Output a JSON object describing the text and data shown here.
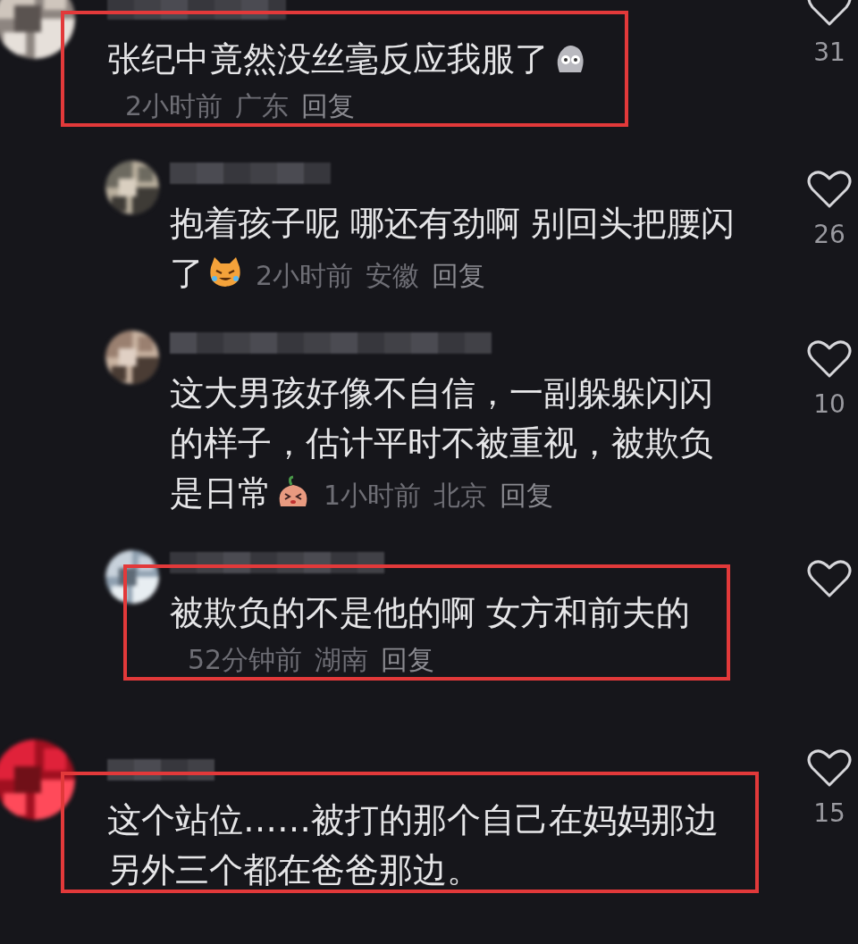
{
  "comments": [
    {
      "kind": "comment",
      "lines": [
        "张纪中竟然没丝毫反应我服了"
      ],
      "emoji": {
        "kind": "shocked"
      },
      "time": "2小时前",
      "location": "广东",
      "reply": "回复",
      "likes": "31",
      "highlighted": true
    },
    {
      "kind": "reply",
      "lines": [
        "抱着孩子呢 哪还有劲啊 别回头把腰闪",
        "了"
      ],
      "emoji": {
        "kind": "crying-laugh"
      },
      "time": "2小时前",
      "location": "安徽",
      "reply": "回复",
      "likes": "26",
      "highlighted": false
    },
    {
      "kind": "reply",
      "lines": [
        "这大男孩好像不自信，一副躲躲闪闪",
        "的样子，估计平时不被重视，被欺负",
        "是日常"
      ],
      "emoji": {
        "kind": "dizzy"
      },
      "time": "1小时前",
      "location": "北京",
      "reply": "回复",
      "likes": "10",
      "highlighted": false
    },
    {
      "kind": "reply",
      "lines": [
        "被欺负的不是他的啊 女方和前夫的"
      ],
      "time": "52分钟前",
      "location": "湖南",
      "reply": "回复",
      "highlighted": true
    },
    {
      "kind": "comment",
      "lines": [
        "这个站位……被打的那个自己在妈妈那边",
        "另外三个都在爸爸那边。"
      ],
      "likes": "15",
      "highlighted": true
    }
  ]
}
